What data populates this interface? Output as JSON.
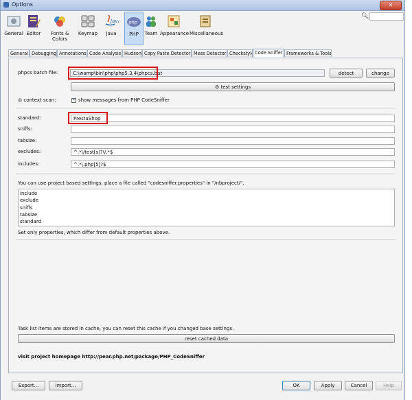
{
  "window": {
    "title": "Options"
  },
  "toolbar": {
    "categories": [
      {
        "label": "General",
        "icon": "general-icon"
      },
      {
        "label": "Editor",
        "icon": "editor-icon"
      },
      {
        "label": "Fonts & Colors",
        "icon": "fonts-colors-icon"
      },
      {
        "label": "Keymap",
        "icon": "keymap-icon"
      },
      {
        "label": "Java",
        "icon": "java-icon"
      },
      {
        "label": "PHP",
        "icon": "php-icon"
      },
      {
        "label": "Team",
        "icon": "team-icon"
      },
      {
        "label": "Appearance",
        "icon": "appearance-icon"
      },
      {
        "label": "Miscellaneous",
        "icon": "miscellaneous-icon"
      }
    ],
    "search_icon": "search-icon"
  },
  "tabs": [
    "General",
    "Debugging",
    "Annotations",
    "Code Analysis",
    "Hudson",
    "Copy Paste Detector",
    "Mess Detector",
    "Checkstyle",
    "Code Sniffer",
    "Frameworks & Tools"
  ],
  "active_tab": "Code Sniffer",
  "form": {
    "batch_label": "phpcs batch file:",
    "batch_value": "C:\\wamp\\bin\\php\\php5.3.4\\phpcs.bat",
    "detect_label": "detect",
    "change_label": "change",
    "test_label": "test settings",
    "context_label": "context scan:",
    "show_messages_label": "show messages from PHP CodeSniffer",
    "standard_label": "standard:",
    "standard_value": "PrestaShop",
    "sniffs_label": "sniffs:",
    "tabsize_label": "tabsize:",
    "excludes_label": "excludes:",
    "excludes_value": "^.*\\/test[s]?\\/.*$",
    "includes_label": "includes:",
    "includes_value": "^.*\\.php[5]?$",
    "project_note": "You can use project based settings, place a file called \"codesniffer.properties\" in \"/nbproject/\".",
    "properties": [
      "include",
      "exclude",
      "sniffs",
      "tabsize",
      "standard"
    ],
    "diff_note": "Set only properties, which differ from default properties above.",
    "cache_note": "Task list items are stored in cache, you can reset this cache if you changed base settings.",
    "reset_label": "reset cached data",
    "homepage_text": "visit project homepage http://pear.php.net/package/PHP_CodeSniffer"
  },
  "footer": {
    "export_label": "Export...",
    "import_label": "Import...",
    "ok_label": "OK",
    "apply_label": "Apply",
    "cancel_label": "Cancel",
    "help_label": "Help"
  },
  "colors": {
    "highlight_box": "#d8141c",
    "selected_category": "#c6dcf5"
  }
}
